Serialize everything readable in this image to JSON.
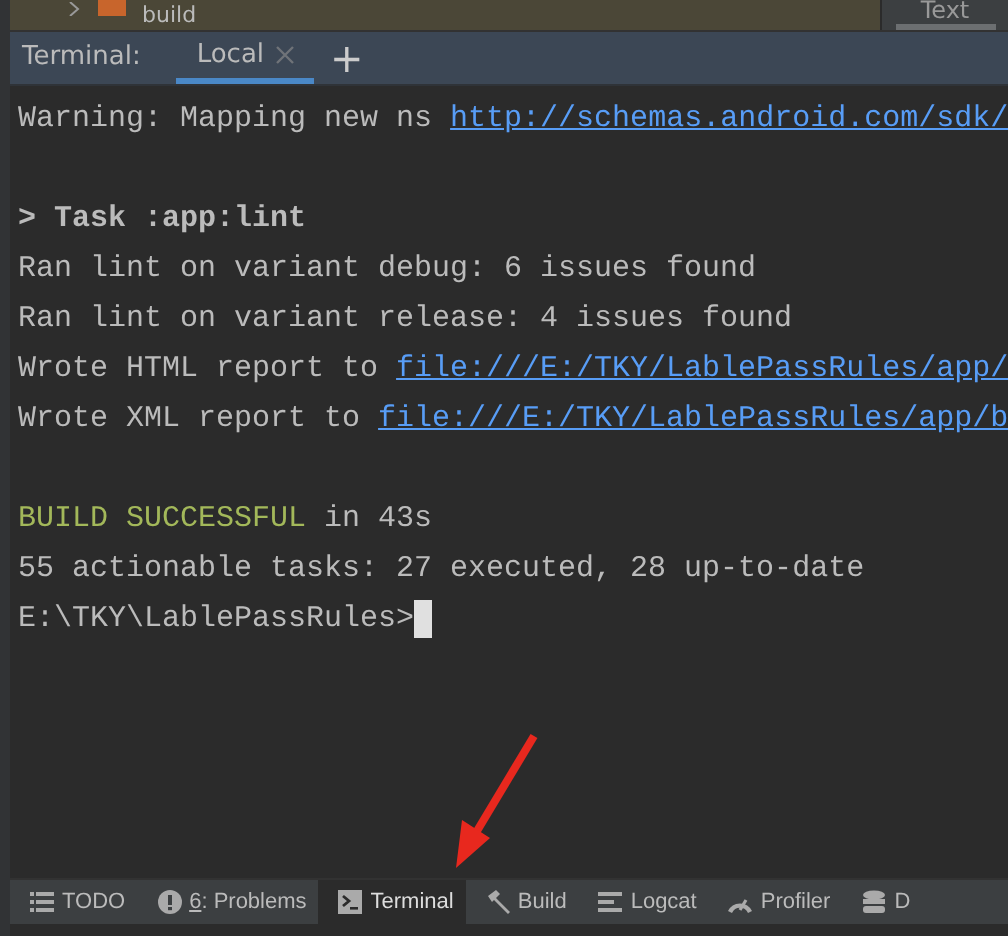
{
  "project_tree": {
    "item": "build",
    "expanded": false
  },
  "side_tab": {
    "label": "Text"
  },
  "terminal": {
    "title": "Terminal:",
    "tabs": [
      {
        "label": "Local",
        "selected": true,
        "closable": true
      }
    ],
    "add_label": "+",
    "blocks": [
      {
        "lines": [
          {
            "segments": [
              {
                "kind": "text",
                "text": "Warning: Mapping new ns "
              },
              {
                "kind": "link",
                "text": "http://schemas.android.com/sdk/"
              }
            ]
          }
        ]
      },
      {
        "lines": [
          {
            "segments": [
              {
                "kind": "bold",
                "text": "> Task :app:lint"
              }
            ]
          },
          {
            "segments": [
              {
                "kind": "text",
                "text": "Ran lint on variant debug: 6 issues found"
              }
            ]
          },
          {
            "segments": [
              {
                "kind": "text",
                "text": "Ran lint on variant release: 4 issues found"
              }
            ]
          },
          {
            "segments": [
              {
                "kind": "text",
                "text": "Wrote HTML report to "
              },
              {
                "kind": "link",
                "text": "file:///E:/TKY/LablePassRules/app/"
              }
            ]
          },
          {
            "segments": [
              {
                "kind": "text",
                "text": "Wrote XML report to "
              },
              {
                "kind": "link",
                "text": "file:///E:/TKY/LablePassRules/app/b"
              }
            ]
          }
        ]
      },
      {
        "lines": [
          {
            "segments": [
              {
                "kind": "success",
                "text": "BUILD SUCCESSFUL"
              },
              {
                "kind": "text",
                "text": " in 43s"
              }
            ]
          },
          {
            "segments": [
              {
                "kind": "text",
                "text": "55 actionable tasks: 27 executed, 28 up-to-date"
              }
            ]
          },
          {
            "cursor": true,
            "segments": [
              {
                "kind": "text",
                "text": "E:\\TKY\\LablePassRules>"
              }
            ]
          }
        ]
      }
    ]
  },
  "tool_windows": [
    {
      "kind": "list",
      "label": "TODO",
      "selected": false,
      "mnemonic": false
    },
    {
      "kind": "problems",
      "label": "6: Problems",
      "selected": false,
      "mnemonic": true
    },
    {
      "kind": "terminal",
      "label": "Terminal",
      "selected": true,
      "mnemonic": false
    },
    {
      "kind": "build",
      "label": "Build",
      "selected": false,
      "mnemonic": false
    },
    {
      "kind": "logcat",
      "label": "Logcat",
      "selected": false,
      "mnemonic": false
    },
    {
      "kind": "profiler",
      "label": "Profiler",
      "selected": false,
      "mnemonic": false
    },
    {
      "kind": "database",
      "label": "D",
      "selected": false,
      "mnemonic": false
    }
  ]
}
